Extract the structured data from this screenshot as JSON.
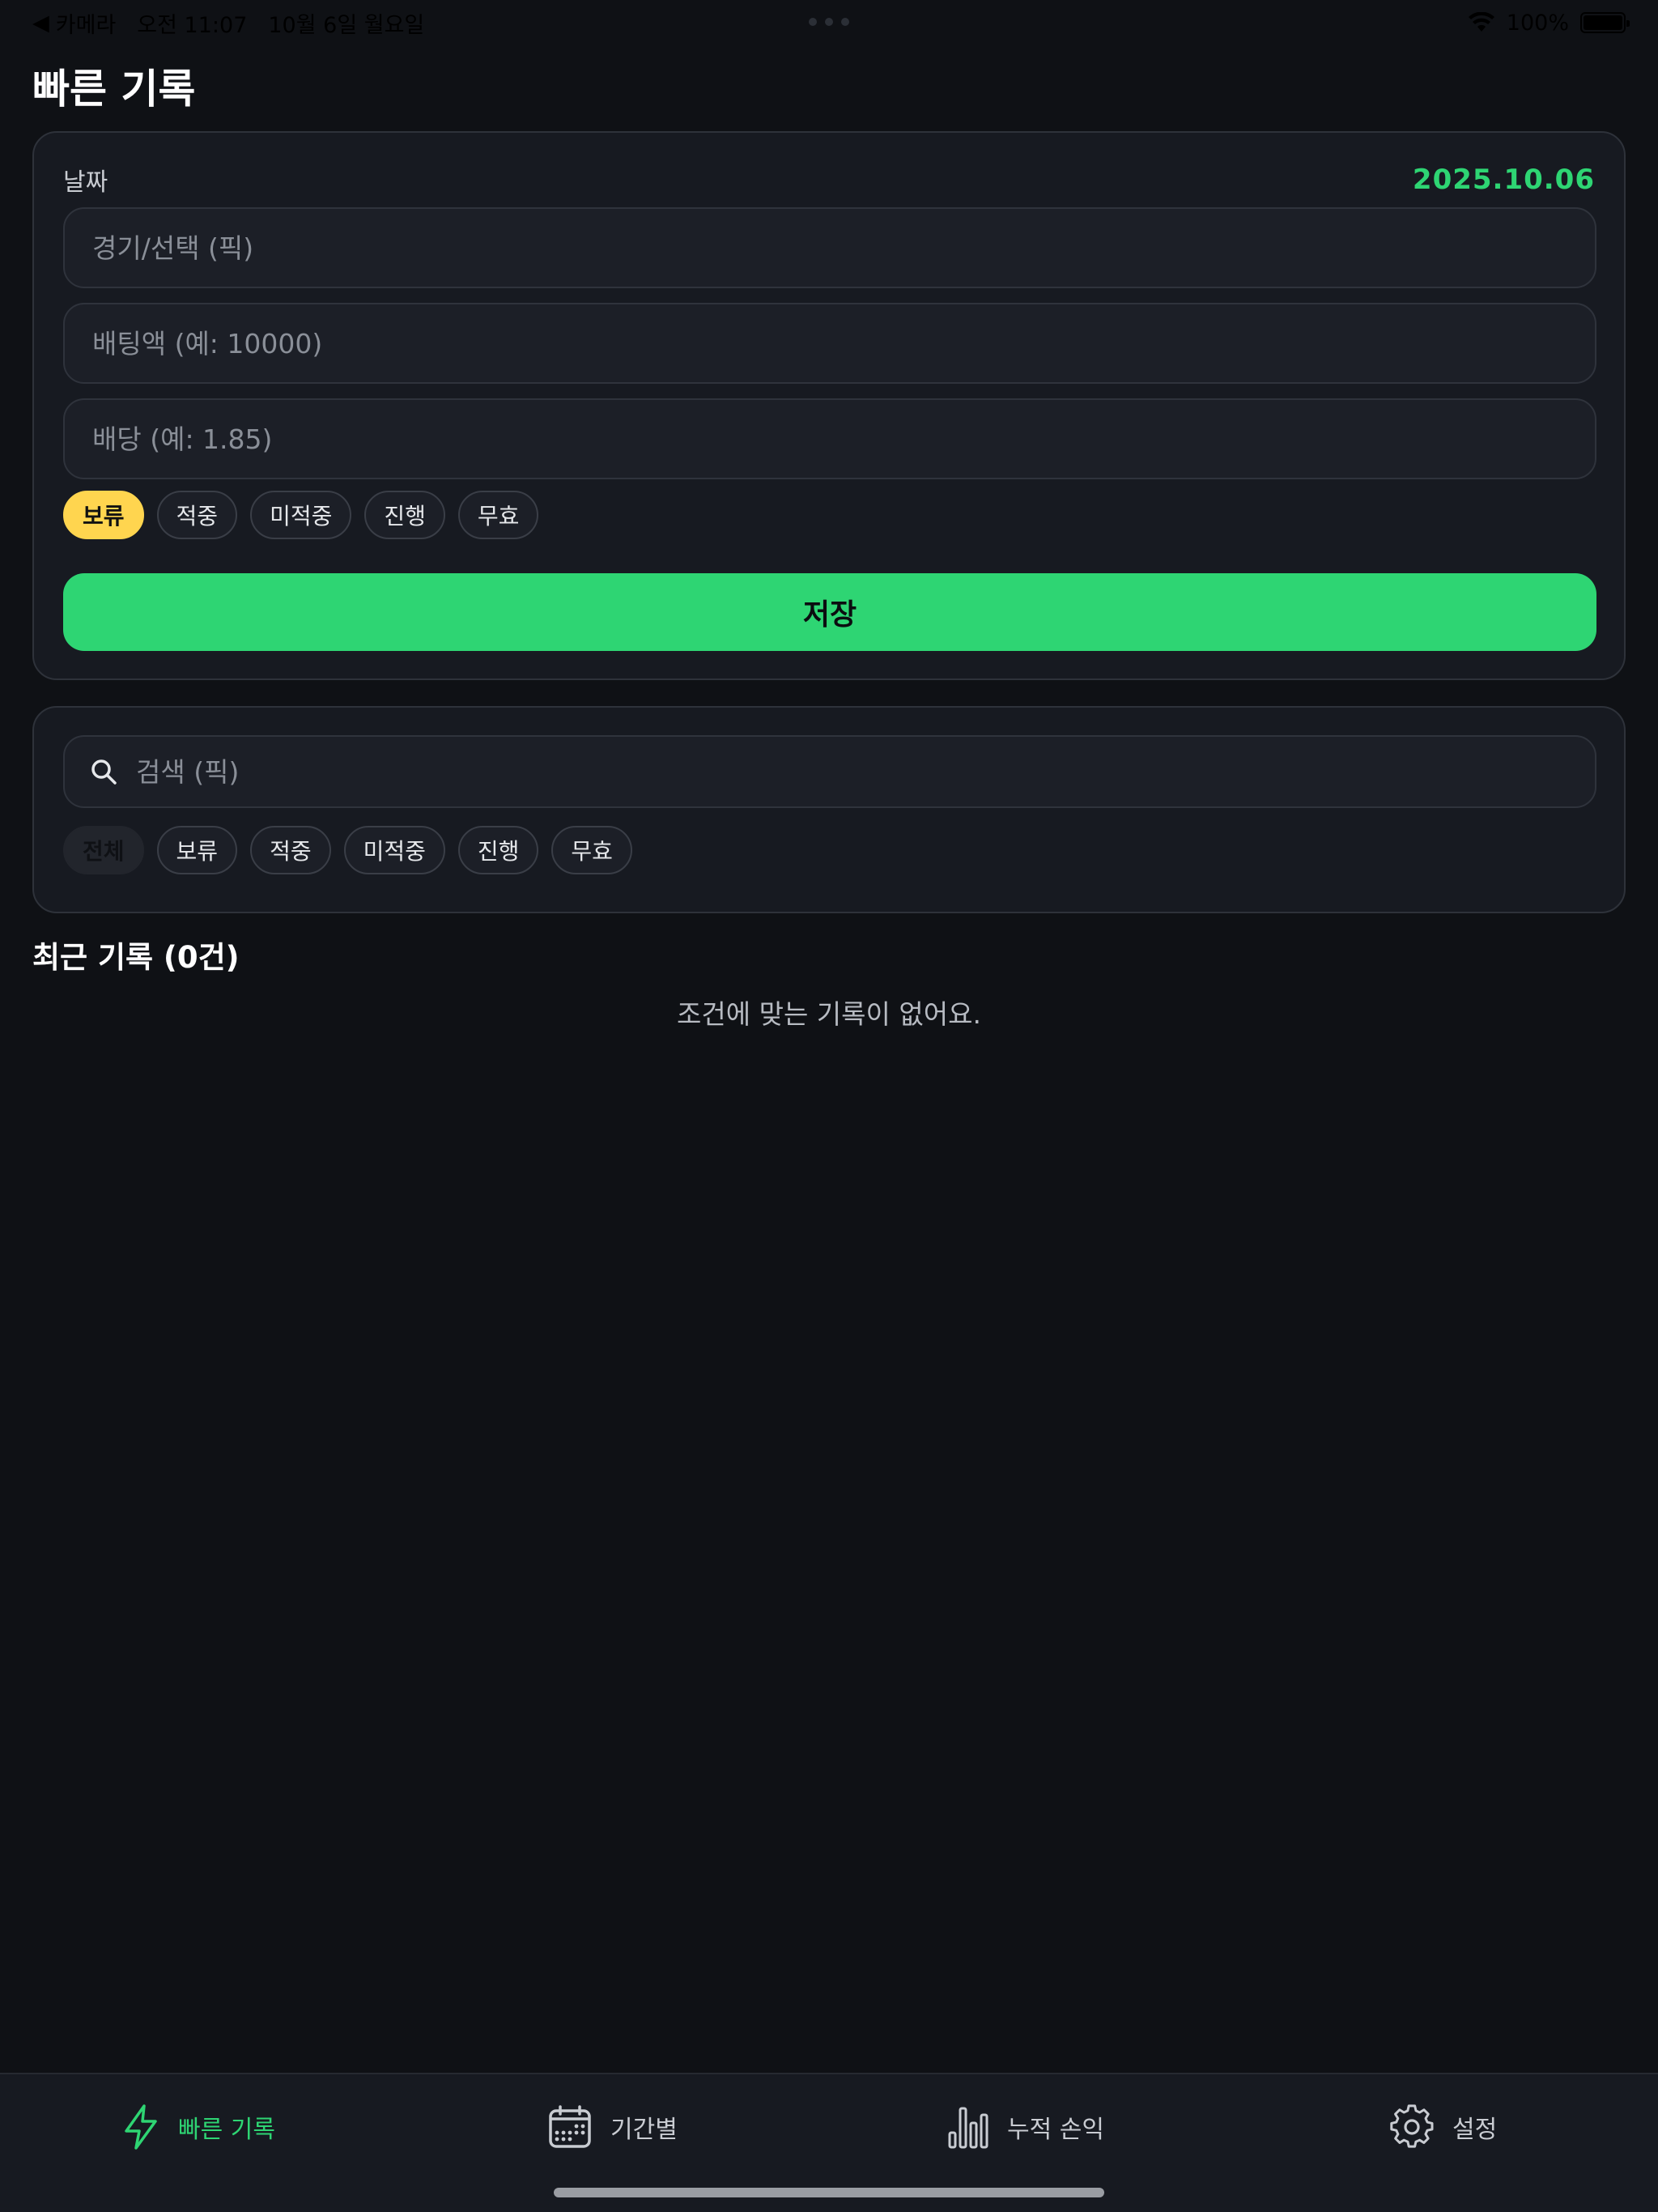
{
  "status_bar": {
    "back_label": "카메라",
    "time": "오전 11:07",
    "date": "10월 6일 월요일",
    "wifi_icon": "wifi-icon",
    "battery_percent": "100%",
    "battery_level": 1.0
  },
  "header": {
    "title": "빠른 기록"
  },
  "entry_form": {
    "date_label": "날짜",
    "date_value": "2025.10.06",
    "pick_placeholder": "경기/선택 (픽)",
    "stake_placeholder": "배팅액 (예: 10000)",
    "odds_placeholder": "배당 (예: 1.85)",
    "status_chips": [
      "보류",
      "적중",
      "미적중",
      "진행",
      "무효"
    ],
    "selected_status": "보류",
    "save_label": "저장"
  },
  "filter": {
    "search_placeholder": "검색 (픽)",
    "chips": [
      "전체",
      "보류",
      "적중",
      "미적중",
      "진행",
      "무효"
    ],
    "selected_chip": "전체"
  },
  "recent": {
    "title": "최근 기록 (0건)",
    "empty_message": "조건에 맞는 기록이 없어요."
  },
  "tabbar": {
    "tabs": [
      {
        "label": "빠른 기록",
        "icon": "lightning-icon",
        "active": true
      },
      {
        "label": "기간별",
        "icon": "calendar-icon",
        "active": false
      },
      {
        "label": "누적 손익",
        "icon": "bar-chart-icon",
        "active": false
      },
      {
        "label": "설정",
        "icon": "gear-icon",
        "active": false
      }
    ]
  },
  "colors": {
    "accent_green": "#2ed573",
    "accent_yellow": "#ffd54f",
    "background": "#0f1115",
    "card": "#171a21"
  }
}
